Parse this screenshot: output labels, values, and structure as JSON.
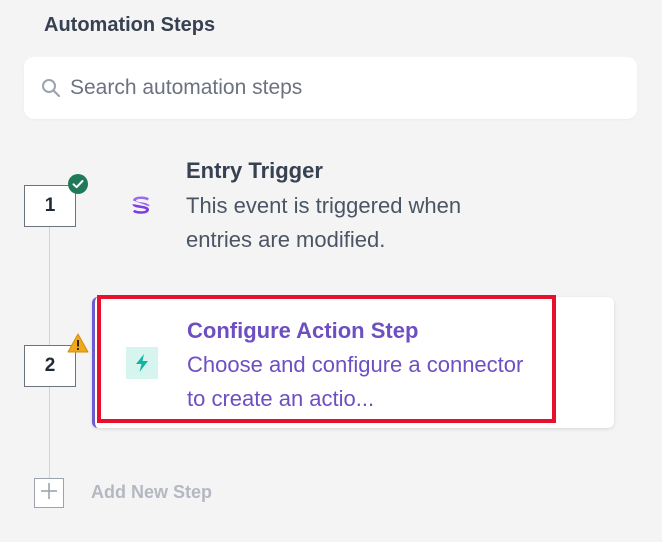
{
  "panel": {
    "title": "Automation Steps"
  },
  "search": {
    "placeholder": "Search automation steps",
    "icon": "search-icon"
  },
  "steps": [
    {
      "number": "1",
      "status": "complete",
      "status_icon": "check-circle-icon",
      "icon": "stack-logo-icon",
      "title": "Entry Trigger",
      "description": "This event is triggered when entries are modified."
    },
    {
      "number": "2",
      "status": "warning",
      "status_icon": "warning-triangle-icon",
      "icon": "lightning-bolt-icon",
      "title": "Configure Action Step",
      "description": "Choose and configure a connector to create an actio..."
    }
  ],
  "add_step": {
    "label": "Add New Step",
    "icon": "plus-icon"
  },
  "colors": {
    "accent": "#6d4fc2",
    "highlight": "#e8112d",
    "success": "#1f7a5a",
    "warning": "#f0a81c"
  }
}
